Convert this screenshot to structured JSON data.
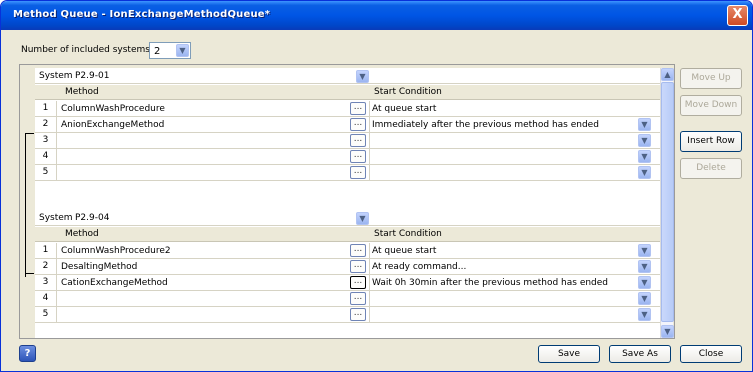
{
  "window": {
    "title": "Method Queue - IonExchangeMethodQueue*",
    "close_label": "X"
  },
  "included_systems": {
    "label": "Number of included systems:",
    "value": "2"
  },
  "systems": [
    {
      "label": "System",
      "value": "P2.9-01",
      "header": {
        "method": "Method",
        "start_condition": "Start Condition"
      },
      "rows": [
        {
          "num": "1",
          "method": "ColumnWashProcedure",
          "condition": "At queue start"
        },
        {
          "num": "2",
          "method": "AnionExchangeMethod",
          "condition": "Immediately after the previous method has ended"
        },
        {
          "num": "3",
          "method": "",
          "condition": ""
        },
        {
          "num": "4",
          "method": "",
          "condition": ""
        },
        {
          "num": "5",
          "method": "",
          "condition": ""
        }
      ]
    },
    {
      "label": "System",
      "value": "P2.9-04",
      "header": {
        "method": "Method",
        "start_condition": "Start Condition"
      },
      "rows": [
        {
          "num": "1",
          "method": "ColumnWashProcedure2",
          "condition": "At queue start"
        },
        {
          "num": "2",
          "method": "DesaltingMethod",
          "condition": "At ready command..."
        },
        {
          "num": "3",
          "method": "CationExchangeMethod",
          "condition": "Wait 0h 30min after the previous method has ended"
        },
        {
          "num": "4",
          "method": "",
          "condition": ""
        },
        {
          "num": "5",
          "method": "",
          "condition": ""
        }
      ]
    }
  ],
  "ellipsis": "...",
  "side_buttons": {
    "move_up": "Move Up",
    "move_down": "Move Down",
    "insert_row": "Insert Row",
    "delete": "Delete"
  },
  "footer": {
    "save": "Save",
    "save_as": "Save As",
    "close": "Close"
  },
  "icons": {
    "help": "help-icon",
    "dropdown": "chevron-down-icon",
    "close": "close-icon"
  },
  "colors": {
    "titlebar": "#0055e5",
    "close": "#cf4a24",
    "dialog_bg": "#ece9d8"
  }
}
